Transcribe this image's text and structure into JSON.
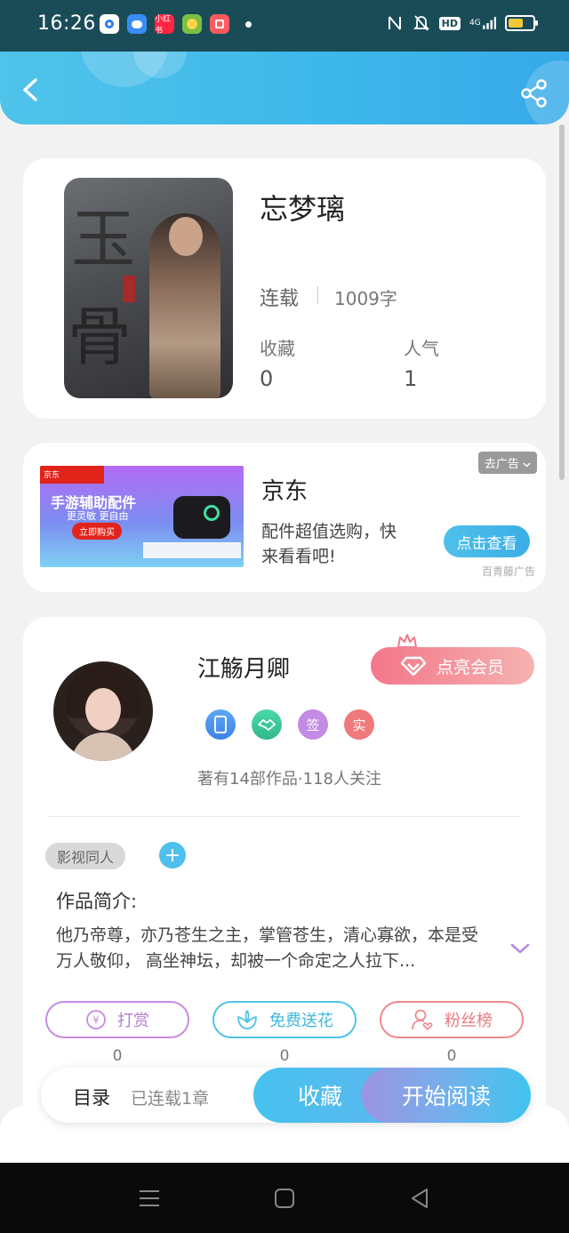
{
  "status_bar": {
    "time": "16:26",
    "app_labels": [
      "",
      "",
      "小红书",
      "",
      ""
    ],
    "network": "4G"
  },
  "header": {
    "back_icon": "chevron-left-icon",
    "share_icon": "share-icon"
  },
  "book": {
    "title": "忘梦璃",
    "status": "连载",
    "word_count": "1009字",
    "stats": [
      {
        "label": "收藏",
        "value": "0"
      },
      {
        "label": "人气",
        "value": "1"
      }
    ]
  },
  "ad": {
    "remove_label": "去广告",
    "image": {
      "brand_strip": "京东",
      "headline": "手游辅助配件",
      "sub": "更灵敏 更自由",
      "cta": "立即购买"
    },
    "title": "京东",
    "description": "配件超值选购，快来看看吧!",
    "button_label": "点击查看",
    "source": "百青藤广告"
  },
  "author": {
    "name": "江觞月卿",
    "vip_label": "点亮会员",
    "badges": [
      "",
      "",
      "签",
      "实"
    ],
    "meta": "著有14部作品·118人关注",
    "tag": "影视同人",
    "tag_add": "+",
    "intro_label": "作品简介:",
    "intro_text": "他乃帝尊，亦乃苍生之主，掌管苍生，清心寡欲，本是受万人敬仰， 高坐神坛，却被一个命定之人拉下...",
    "actions": [
      {
        "label": "打赏",
        "count": "0"
      },
      {
        "label": "免费送花",
        "count": "0"
      },
      {
        "label": "粉丝榜",
        "count": "0"
      }
    ]
  },
  "action_bar": {
    "toc_label": "目录",
    "chapters_label": "已连载1章",
    "favorite_label": "收藏",
    "read_label": "开始阅读"
  },
  "colors": {
    "header_blue": "#3db7ea",
    "vip_pink": "#f3778a",
    "read_purple": "#9d94e2"
  }
}
